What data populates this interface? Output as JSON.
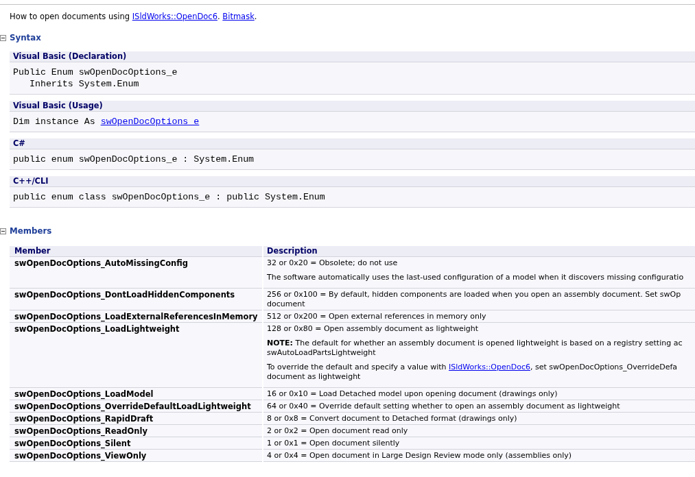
{
  "intro": {
    "parts": [
      {
        "kind": "text",
        "text": "How to open documents using "
      },
      {
        "kind": "link",
        "text": "ISldWorks::OpenDoc6"
      },
      {
        "kind": "text",
        "text": ". "
      },
      {
        "kind": "link",
        "text": "Bitmask"
      },
      {
        "kind": "text",
        "text": "."
      }
    ]
  },
  "syntax": {
    "title": "Syntax",
    "expanded": true,
    "blocks": [
      {
        "title": "Visual Basic (Declaration)",
        "lines": [
          [
            {
              "kind": "text",
              "text": "Public Enum swOpenDocOptions_e"
            }
          ],
          [
            {
              "kind": "text",
              "text": "   Inherits System.Enum"
            }
          ]
        ]
      },
      {
        "title": "Visual Basic (Usage)",
        "lines": [
          [
            {
              "kind": "text",
              "text": "Dim instance As "
            },
            {
              "kind": "link",
              "text": "swOpenDocOptions_e"
            }
          ]
        ]
      },
      {
        "title": "C#",
        "lines": [
          [
            {
              "kind": "text",
              "text": "public enum swOpenDocOptions_e : System.Enum"
            }
          ]
        ]
      },
      {
        "title": "C++/CLI",
        "lines": [
          [
            {
              "kind": "text",
              "text": "public enum class swOpenDocOptions_e : public System.Enum"
            }
          ]
        ]
      }
    ]
  },
  "members": {
    "title": "Members",
    "expanded": true,
    "columns": [
      "Member",
      "Description"
    ],
    "rows": [
      {
        "member": "swOpenDocOptions_AutoMissingConfig",
        "description": [
          [
            {
              "kind": "text",
              "text": "32 or 0x20 = Obsolete; do not use"
            }
          ],
          [
            {
              "kind": "text",
              "text": "The software automatically uses the last-used configuration of a model when it discovers missing configuratio"
            }
          ]
        ]
      },
      {
        "member": "swOpenDocOptions_DontLoadHiddenComponents",
        "description": [
          [
            {
              "kind": "text",
              "text": "256 or 0x100 = By default, hidden components are loaded when you open an assembly document. Set swOp\ndocument"
            }
          ]
        ]
      },
      {
        "member": "swOpenDocOptions_LoadExternalReferencesInMemory",
        "description": [
          [
            {
              "kind": "text",
              "text": "512 or 0x200 = Open external references in memory only"
            }
          ]
        ]
      },
      {
        "member": "swOpenDocOptions_LoadLightweight",
        "description": [
          [
            {
              "kind": "text",
              "text": "128 or 0x80 = Open assembly document as lightweight"
            }
          ],
          [
            {
              "kind": "text",
              "text": "**NOTE:** The default for whether an assembly document is opened lightweight is based on a registry setting ac\nswAutoLoadPartsLightweight"
            }
          ],
          [
            {
              "kind": "text",
              "text": "To override the default and specify a value with "
            },
            {
              "kind": "link",
              "text": "ISldWorks::OpenDoc6"
            },
            {
              "kind": "text",
              "text": ", set swOpenDocOptions_OverrideDefa\ndocument as lightweight"
            }
          ]
        ]
      },
      {
        "member": "swOpenDocOptions_LoadModel",
        "description": [
          [
            {
              "kind": "text",
              "text": "16 or 0x10 = Load Detached model upon opening document (drawings only)"
            }
          ]
        ]
      },
      {
        "member": "swOpenDocOptions_OverrideDefaultLoadLightweight",
        "description": [
          [
            {
              "kind": "text",
              "text": "64 or 0x40 = Override default setting whether to open an assembly document as lightweight"
            }
          ]
        ]
      },
      {
        "member": "swOpenDocOptions_RapidDraft",
        "description": [
          [
            {
              "kind": "text",
              "text": "8 or 0x8 = Convert document to Detached format (drawings only)"
            }
          ]
        ]
      },
      {
        "member": "swOpenDocOptions_ReadOnly",
        "description": [
          [
            {
              "kind": "text",
              "text": "2 or 0x2 = Open document read only"
            }
          ]
        ]
      },
      {
        "member": "swOpenDocOptions_Silent",
        "description": [
          [
            {
              "kind": "text",
              "text": "1 or 0x1 = Open document silently"
            }
          ]
        ]
      },
      {
        "member": "swOpenDocOptions_ViewOnly",
        "description": [
          [
            {
              "kind": "text",
              "text": "4 or 0x4 = Open document in Large Design Review mode only (assemblies only)"
            }
          ]
        ]
      }
    ]
  }
}
